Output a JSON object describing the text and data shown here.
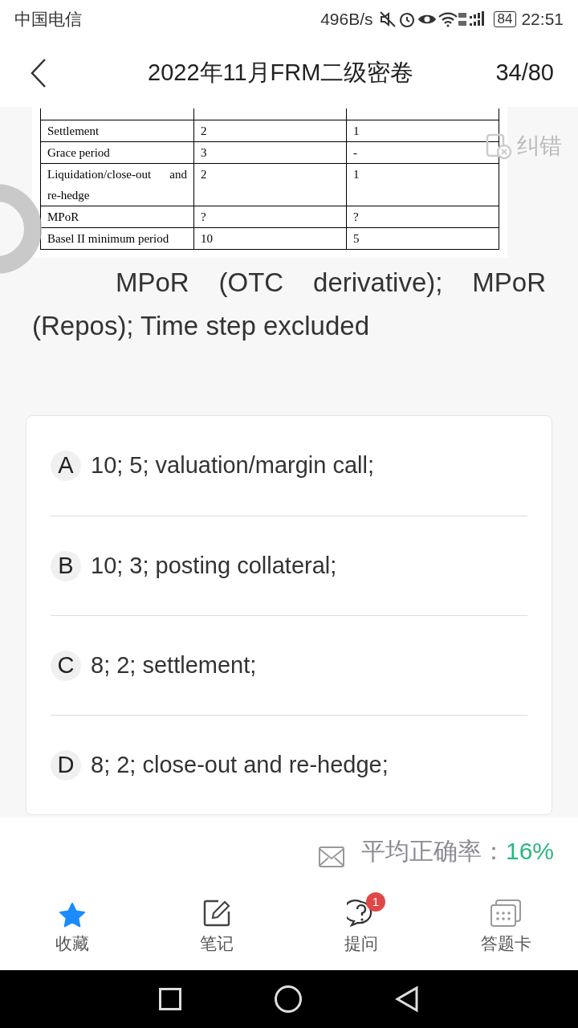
{
  "status_bar": {
    "carrier": "中国电信",
    "speed": "496B/s",
    "battery": "84",
    "time": "22:51"
  },
  "header": {
    "title": "2022年11月FRM二级密卷",
    "progress": "34/80"
  },
  "table": {
    "rows": [
      [
        "Settlement",
        "2",
        "1"
      ],
      [
        "Grace period",
        "3",
        "-"
      ],
      [
        "Liquidation/close-out  and re-hedge",
        "2",
        "1"
      ],
      [
        "MPoR",
        "?",
        "?"
      ],
      [
        "Basel II minimum period",
        "10",
        "5"
      ]
    ]
  },
  "report": {
    "label": "纠错"
  },
  "question": "MPoR (OTC derivative); MPoR (Repos); Time step excluded",
  "options": [
    {
      "letter": "A",
      "text": "10; 5; valuation/margin call;"
    },
    {
      "letter": "B",
      "text": "10; 3; posting collateral;"
    },
    {
      "letter": "C",
      "text": "8; 2; settlement;"
    },
    {
      "letter": "D",
      "text": "8; 2; close-out and re-hedge;"
    }
  ],
  "accuracy": {
    "label": "平均正确率：",
    "value": "16%"
  },
  "tabs": [
    {
      "kind": "favorite",
      "label": "收藏",
      "active": true
    },
    {
      "kind": "note",
      "label": "笔记",
      "active": false
    },
    {
      "kind": "ask",
      "label": "提问",
      "active": false,
      "badge": "1"
    },
    {
      "kind": "card",
      "label": "答题卡",
      "active": false
    }
  ]
}
